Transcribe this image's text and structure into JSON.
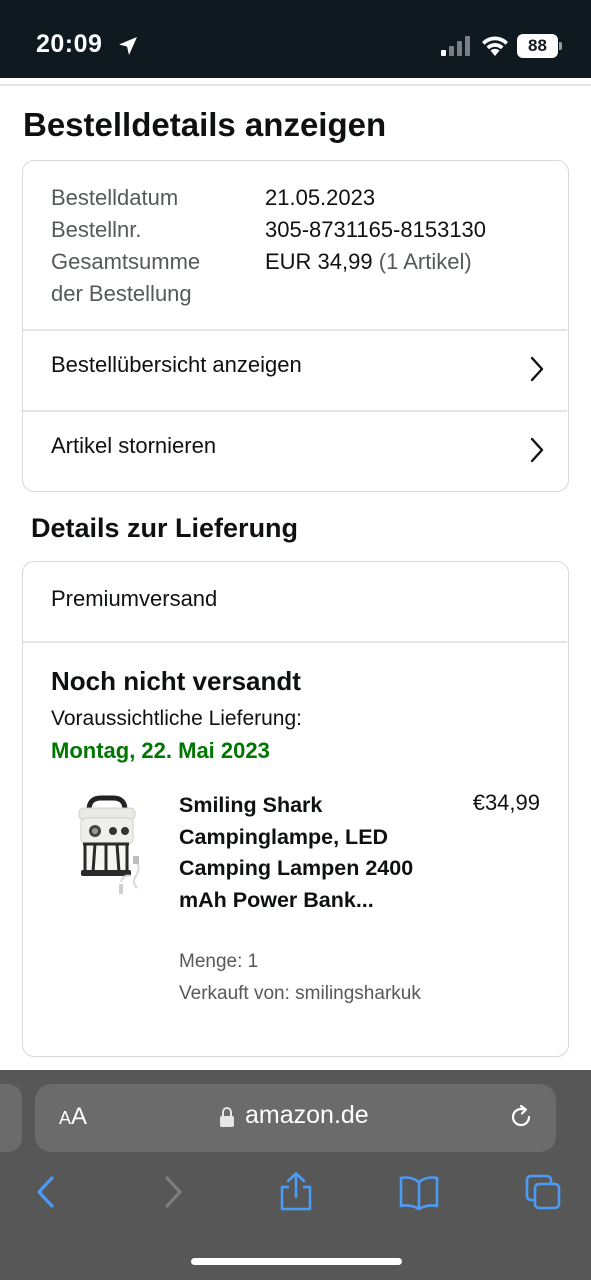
{
  "status_bar": {
    "time": "20:09",
    "battery": "88",
    "icons": [
      "location-arrow-icon",
      "signal-icon",
      "wifi-icon",
      "battery-icon"
    ]
  },
  "page": {
    "title": "Bestelldetails anzeigen"
  },
  "order_summary": {
    "date_label": "Bestelldatum",
    "date_value": "21.05.2023",
    "number_label": "Bestellnr.",
    "number_value": "305-8731165-8153130",
    "total_label_line1": "Gesamtsumme",
    "total_label_line2": "der Bestellung",
    "total_value": "EUR 34,99",
    "total_items": "(1 Artikel)",
    "links": [
      {
        "label": "Bestellübersicht anzeigen"
      },
      {
        "label": "Artikel stornieren"
      }
    ]
  },
  "delivery": {
    "section_title": "Details zur Lieferung",
    "shipping_method": "Premiumversand",
    "status": "Noch nicht versandt",
    "eta_label": "Voraussichtliche Lieferung:",
    "eta_date": "Montag, 22. Mai 2023",
    "item": {
      "title": "Smiling Shark Campinglampe, LED Camping Lampen 2400 mAh Power Bank...",
      "price": "€34,99",
      "quantity": "Menge: 1",
      "seller": "Verkauft von: smilingsharkuk"
    }
  },
  "browser": {
    "aa_small": "A",
    "aa_big": "A",
    "url": "amazon.de",
    "accent_color": "#4a9bf5"
  }
}
